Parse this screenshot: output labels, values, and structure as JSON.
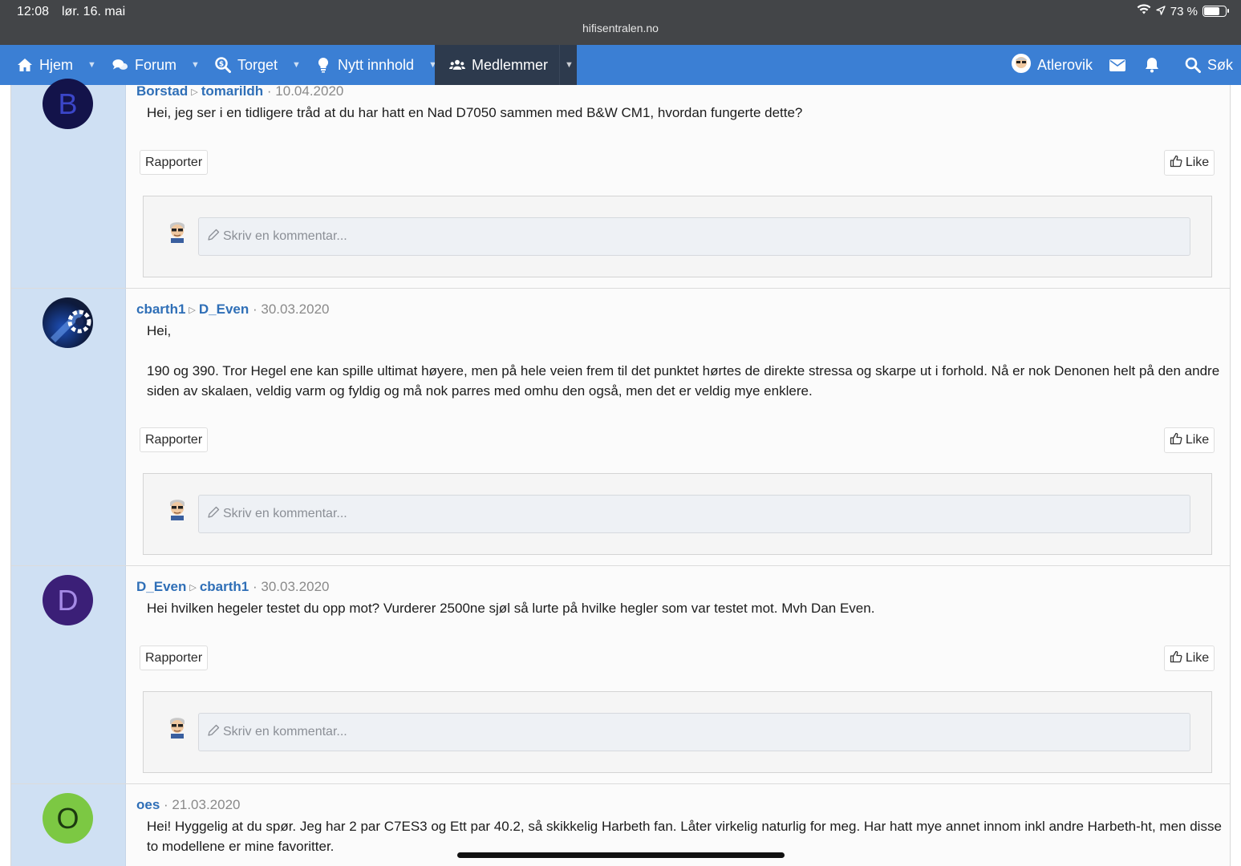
{
  "status_bar": {
    "time": "12:08",
    "date": "lør. 16. mai",
    "url": "hifisentralen.no",
    "battery": "73 %",
    "battery_level": 0.73
  },
  "nav": {
    "home": "Hjem",
    "forum": "Forum",
    "market": "Torget",
    "new_content": "Nytt innhold",
    "members": "Medlemmer",
    "user": "Atlerovik",
    "search": "Søk"
  },
  "posts": [
    {
      "author": "Borstad",
      "recipient": "tomarildh",
      "date": "10.04.2020",
      "avatar_letter": "B",
      "paragraphs": [
        "Hei, jeg ser i en tidligere tråd at du har hatt en Nad D7050 sammen med B&W CM1, hvordan fungerte dette?"
      ],
      "report": "Rapporter",
      "like": "Like",
      "comment_placeholder": "Skriv en kommentar..."
    },
    {
      "author": "cbarth1",
      "recipient": "D_Even",
      "date": "30.03.2020",
      "paragraphs": [
        "Hei,",
        "190 og 390. Tror Hegel ene kan spille ultimat høyere, men på hele veien frem til det punktet hørtes de direkte stressa og skarpe ut i forhold. Nå er nok Denonen helt på den andre siden av skalaen, veldig varm og fyldig og må nok parres med omhu den også, men det er veldig mye enklere."
      ],
      "report": "Rapporter",
      "like": "Like",
      "comment_placeholder": "Skriv en kommentar..."
    },
    {
      "author": "D_Even",
      "recipient": "cbarth1",
      "date": "30.03.2020",
      "avatar_letter": "D",
      "paragraphs": [
        "Hei hvilken hegeler testet du opp mot? Vurderer 2500ne sjøl så lurte på hvilke hegler som var testet mot. Mvh Dan Even."
      ],
      "report": "Rapporter",
      "like": "Like",
      "comment_placeholder": "Skriv en kommentar..."
    },
    {
      "author": "oes",
      "date": "21.03.2020",
      "avatar_letter": "O",
      "paragraphs": [
        "Hei! Hyggelig at du spør. Jeg har 2 par C7ES3 og Ett par 40.2, så skikkelig Harbeth fan. Låter virkelig naturlig for meg. Har hatt mye annet innom inkl andre Harbeth-ht, men disse to modellene er mine favoritter."
      ]
    }
  ],
  "colors": {
    "nav": "#3b7fd4",
    "nav_active": "#2d3a4d",
    "gutter": "#cfe0f3",
    "username": "#2f6fb7"
  }
}
